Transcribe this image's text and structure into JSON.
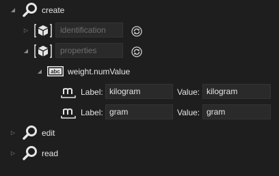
{
  "tree": {
    "create": {
      "label": "create",
      "expanded": true
    },
    "identification": {
      "placeholder": "identification",
      "expanded": false
    },
    "properties": {
      "placeholder": "properties",
      "expanded": true
    },
    "property": {
      "label": "weight.numValue",
      "icon": "abc-icon",
      "expanded": true
    },
    "units": [
      {
        "label_caption": "Label:",
        "label_value": "kilogram",
        "value_caption": "Value:",
        "value_value": "kilogram"
      },
      {
        "label_caption": "Label:",
        "label_value": "gram",
        "value_caption": "Value:",
        "value_value": "gram"
      }
    ],
    "edit": {
      "label": "edit",
      "expanded": false
    },
    "read": {
      "label": "read",
      "expanded": false
    }
  },
  "icons": {
    "collapsed_arrow": "▷",
    "expanded_arrow": "◢",
    "abc_text": "abc"
  },
  "colors": {
    "background": "#1e1e1e",
    "text": "#e6e6e6",
    "field_bg": "#2a2a2a",
    "placeholder": "#6f6f6f"
  }
}
